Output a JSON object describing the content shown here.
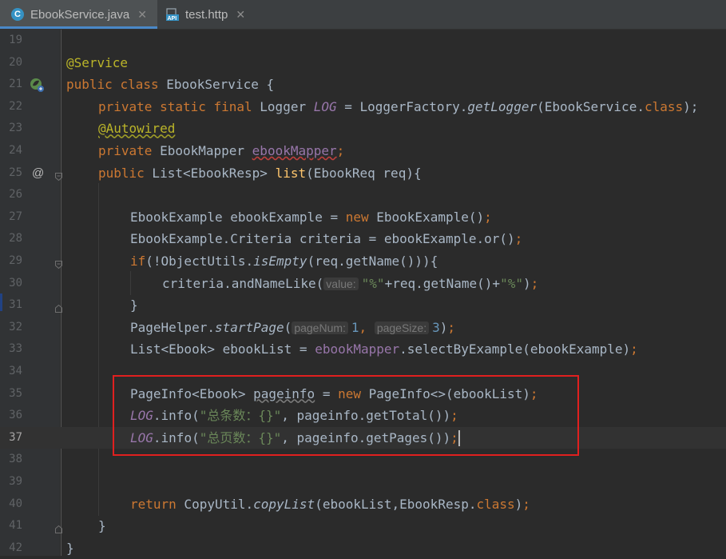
{
  "tabs": [
    {
      "label": "EbookService.java",
      "icon": "java-class-icon",
      "active": true
    },
    {
      "label": "test.http",
      "icon": "api-file-icon",
      "active": false
    }
  ],
  "gutter": {
    "line_numbers": [
      "19",
      "20",
      "21",
      "22",
      "23",
      "24",
      "25",
      "26",
      "27",
      "28",
      "29",
      "30",
      "31",
      "32",
      "33",
      "34",
      "35",
      "36",
      "37",
      "38",
      "39",
      "40",
      "41",
      "42"
    ],
    "current_line": "37",
    "override_marker": "@"
  },
  "code": {
    "l20": {
      "ann": "@Service"
    },
    "l21": {
      "kw1": "public",
      "kw2": "class",
      "name": " EbookService {"
    },
    "l22": {
      "kw": "private static final",
      "t1": " Logger ",
      "f1": "LOG",
      "t2": " = LoggerFactory.",
      "m1": "getLogger",
      "t3": "(EbookService.",
      "kw2": "class",
      "t4": ");"
    },
    "l23": {
      "ann": "@Autowired"
    },
    "l24": {
      "kw": "private",
      "t1": " EbookMapper ",
      "f1": "ebookMapper",
      "t2": ";"
    },
    "l25": {
      "kw": "public",
      "t1": " List<EbookResp> ",
      "m1": "list",
      "t2": "(EbookReq req){"
    },
    "l27": {
      "t1": "EbookExample ebookExample = ",
      "kw": "new",
      "t2": " EbookExample()",
      "t3": ";"
    },
    "l28": {
      "t1": "EbookExample.Criteria criteria = ebookExample.or()",
      "t2": ";"
    },
    "l29": {
      "kw": "if",
      "t1": "(!ObjectUtils.",
      "m1": "isEmpty",
      "t2": "(req.getName())){"
    },
    "l30": {
      "t1": "criteria.andNameLike(",
      "hint": "value:",
      "s1": "\"%\"",
      "t2": "+req.getName()+",
      "s2": "\"%\"",
      "t3": ")",
      "t4": ";"
    },
    "l31": {
      "t1": "}"
    },
    "l32": {
      "t1": "PageHelper.",
      "m1": "startPage",
      "t2": "(",
      "hint1": "pageNum:",
      "n1": "1",
      "t3": ", ",
      "hint2": "pageSize:",
      "n2": "3",
      "t4": ")",
      "t5": ";"
    },
    "l33": {
      "t1": "List<Ebook> ebookList = ",
      "f1": "ebookMapper",
      "t2": ".selectByExample(ebookExample)",
      "t3": ";"
    },
    "l35": {
      "t1": "PageInfo<Ebook> ",
      "v1": "pageinfo",
      "t2": " = ",
      "kw": "new",
      "t3": " PageInfo<>(ebookList)",
      "t4": ";"
    },
    "l36": {
      "f1": "LOG",
      "t1": ".info(",
      "s1": "\"总条数：{}\"",
      "t2": ", pageinfo.getTotal())",
      "t3": ";"
    },
    "l37": {
      "f1": "LOG",
      "t1": ".info(",
      "s1": "\"总页数：{}\"",
      "t2": ", pageinfo.getPages())",
      "t3": ";"
    },
    "l40": {
      "kw": "return",
      "t1": " CopyUtil.",
      "m1": "copyList",
      "t2": "(ebookList,EbookResp.",
      "kw2": "class",
      "t3": ")",
      "t4": ";"
    },
    "l41": {
      "t1": "}"
    },
    "l42": {
      "t1": "}"
    }
  },
  "colors": {
    "background": "#2b2b2b",
    "keyword": "#cc7832",
    "annotation": "#bbb529",
    "string": "#6a8759",
    "number": "#6897bb",
    "field": "#9876aa",
    "method_decl": "#ffc66d",
    "highlight_box": "#e0201f"
  }
}
